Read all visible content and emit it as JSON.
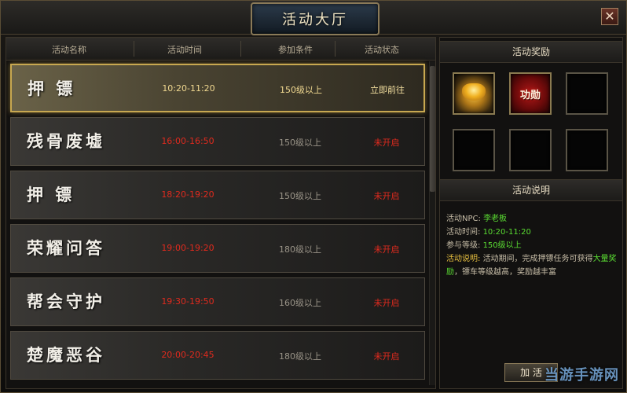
{
  "window": {
    "title": "活动大厅",
    "close_label": "✕"
  },
  "list": {
    "headers": [
      "活动名称",
      "活动时间",
      "参加条件",
      "活动状态"
    ],
    "rows": [
      {
        "name": "押  镖",
        "time": "10:20-11:20",
        "condition": "150级以上",
        "status": "立即前往",
        "active": true
      },
      {
        "name": "残骨废墟",
        "time": "16:00-16:50",
        "condition": "150级以上",
        "status": "未开启",
        "active": false
      },
      {
        "name": "押  镖",
        "time": "18:20-19:20",
        "condition": "150级以上",
        "status": "未开启",
        "active": false
      },
      {
        "name": "荣耀问答",
        "time": "19:00-19:20",
        "condition": "180级以上",
        "status": "未开启",
        "active": false
      },
      {
        "name": "帮会守护",
        "time": "19:30-19:50",
        "condition": "160级以上",
        "status": "未开启",
        "active": false
      },
      {
        "name": "楚魔恶谷",
        "time": "20:00-20:45",
        "condition": "180级以上",
        "status": "未开启",
        "active": false
      }
    ]
  },
  "rewards": {
    "header": "活动奖励",
    "items": [
      {
        "icon": "gold-ingot-icon",
        "label": ""
      },
      {
        "icon": "merit-icon",
        "label": "功勋"
      },
      {
        "icon": "empty",
        "label": ""
      },
      {
        "icon": "empty",
        "label": ""
      },
      {
        "icon": "empty",
        "label": ""
      },
      {
        "icon": "empty",
        "label": ""
      }
    ]
  },
  "info": {
    "header": "活动说明",
    "npc_label": "活动NPC:",
    "npc_value": "李老板",
    "time_label": "活动时间:",
    "time_value": "10:20-11:20",
    "level_label": "参与等级:",
    "level_value": "150级以上",
    "desc_label": "活动说明:",
    "desc_text_1": "活动期间，完成押镖任务可获得",
    "desc_highlight": "大量奖励",
    "desc_text_2": "，镖车等级越高，奖励越丰富"
  },
  "join_button": "加 活",
  "watermark": "当游手游网",
  "colors": {
    "gold": "#c8a850",
    "red_status": "#e02a1e",
    "green_value": "#5adc32"
  }
}
